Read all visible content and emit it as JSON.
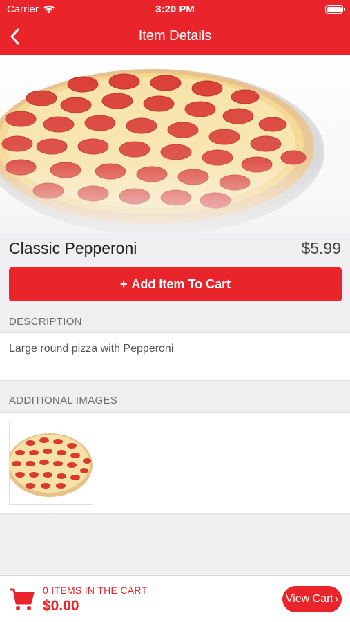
{
  "status_bar": {
    "carrier": "Carrier",
    "time": "3:20 PM"
  },
  "nav": {
    "title": "Item Details",
    "back_icon": "chevron-left-icon"
  },
  "item": {
    "name": "Classic Pepperoni",
    "price": "$5.99"
  },
  "add_button": {
    "icon": "+",
    "label": "Add Item To Cart"
  },
  "description": {
    "header": "DESCRIPTION",
    "text": "Large round pizza with Pepperoni"
  },
  "additional_images": {
    "header": "ADDITIONAL IMAGES"
  },
  "cart": {
    "count_label": "0 ITEMS IN THE CART",
    "total": "$0.00",
    "view_cart_label": "View Cart",
    "view_cart_icon": "›"
  },
  "colors": {
    "accent": "#e9242b",
    "background": "#efeff1"
  }
}
